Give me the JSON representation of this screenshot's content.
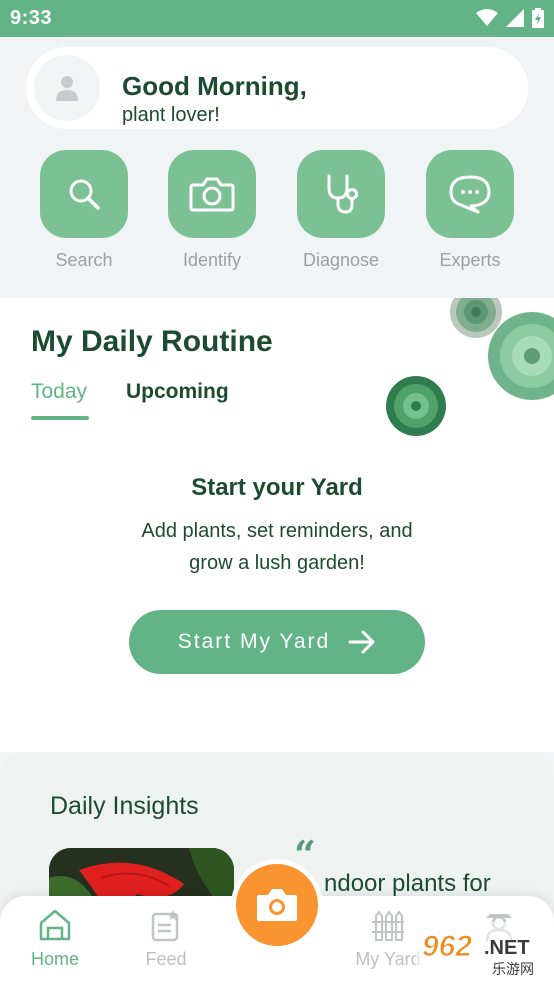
{
  "status_bar": {
    "time": "9:33"
  },
  "greeting": {
    "title": "Good Morning,",
    "subtitle": "plant lover!"
  },
  "quick_actions": [
    {
      "label": "Search",
      "icon": "search-icon"
    },
    {
      "label": "Identify",
      "icon": "camera-icon"
    },
    {
      "label": "Diagnose",
      "icon": "stethoscope-icon"
    },
    {
      "label": "Experts",
      "icon": "chat-bubble-icon"
    }
  ],
  "routine": {
    "title": "My Daily Routine",
    "tabs": [
      {
        "label": "Today",
        "active": true
      },
      {
        "label": "Upcoming",
        "active": false
      }
    ],
    "empty_title": "Start your Yard",
    "empty_description": "Add plants, set reminders, and grow a lush garden!",
    "button_label": "Start My Yard"
  },
  "insights": {
    "title": "Daily Insights",
    "quote_mark": "“",
    "card_text": "ndoor plants for"
  },
  "bottom_nav": [
    {
      "label": "Home",
      "icon": "home-icon",
      "active": true
    },
    {
      "label": "Feed",
      "icon": "feed-icon",
      "active": false
    },
    {
      "label": "My Yard",
      "icon": "fence-icon",
      "active": false
    },
    {
      "label": "",
      "icon": "gardener-icon",
      "active": false
    }
  ],
  "watermark": {
    "text": "962.NET",
    "subtext": "乐游网"
  },
  "colors": {
    "brand_green": "#62b487",
    "tile_green": "#7cc194",
    "dark_green": "#1d4b31",
    "camera_orange": "#f99431"
  }
}
